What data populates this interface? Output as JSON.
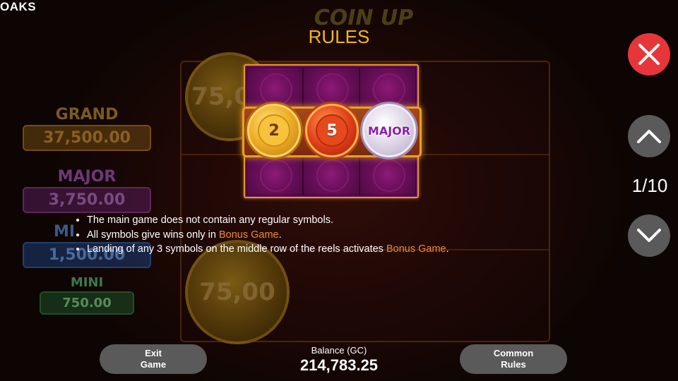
{
  "brand": "OAKS",
  "title": "RULES",
  "background": {
    "logo_text": "COIN UP",
    "coin_values": [
      "75,00",
      "75,00"
    ],
    "jackpots": [
      {
        "label": "GRAND",
        "value": "37,500.00",
        "color": "#8a5a12"
      },
      {
        "label": "MAJOR",
        "value": "3,750.00",
        "color": "#6a2a6a"
      },
      {
        "label": "MI",
        "value": "1,500.00",
        "color": "#1c3f7a"
      },
      {
        "label": "MINI",
        "value": "750.00",
        "color": "#1d5a2a"
      }
    ]
  },
  "illustration": {
    "coins": [
      {
        "type": "gold",
        "label": "2"
      },
      {
        "type": "red",
        "label": "5"
      },
      {
        "type": "silver",
        "label": "MAJOR"
      }
    ]
  },
  "rules": [
    {
      "text": "The main game does not contain any regular symbols.",
      "highlight": "",
      "suffix": ""
    },
    {
      "text": "All symbols give wins only in ",
      "highlight": "Bonus Game",
      "suffix": "."
    },
    {
      "text": "Landing of any 3 symbols on the middle row of the reels activates ",
      "highlight": "Bonus Game",
      "suffix": "."
    }
  ],
  "controls": {
    "page_indicator": "1/10",
    "close_icon": "close-icon",
    "up_icon": "chevron-up-icon",
    "down_icon": "chevron-down-icon"
  },
  "bottom": {
    "exit_line1": "Exit",
    "exit_line2": "Game",
    "balance_label": "Balance (GC)",
    "balance_value": "214,783.25",
    "common_line1": "Common",
    "common_line2": "Rules"
  },
  "colors": {
    "title": "#f3b71a",
    "highlight": "#f08a2e",
    "close_button": "#e6363a",
    "nav_button": "#5a5a5a"
  }
}
